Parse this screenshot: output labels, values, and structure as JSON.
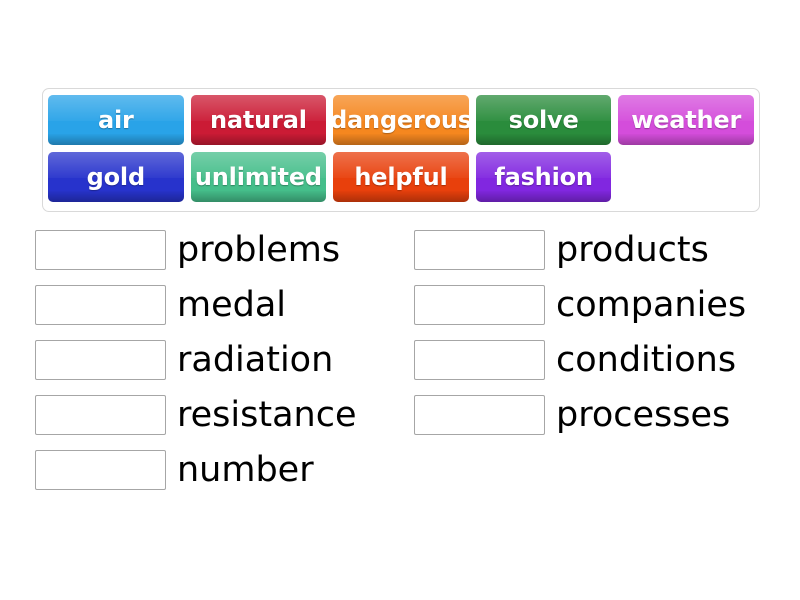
{
  "word_bank": {
    "rows": [
      [
        {
          "label": "air",
          "color": "#29A3E8"
        },
        {
          "label": "natural",
          "color": "#CB1B35"
        },
        {
          "label": "dangerous",
          "color": "#F5871F"
        },
        {
          "label": "solve",
          "color": "#2A8C3C"
        },
        {
          "label": "weather",
          "color": "#D44DDB"
        }
      ],
      [
        {
          "label": "gold",
          "color": "#2733CC"
        },
        {
          "label": "unlimited",
          "color": "#45BE8A"
        },
        {
          "label": "helpful",
          "color": "#E8400C"
        },
        {
          "label": "fashion",
          "color": "#8127E0"
        },
        {
          "label": "",
          "color": "",
          "empty": true
        }
      ]
    ]
  },
  "answers": {
    "left": [
      {
        "slot_value": "",
        "label": "problems"
      },
      {
        "slot_value": "",
        "label": "medal"
      },
      {
        "slot_value": "",
        "label": "radiation"
      },
      {
        "slot_value": "",
        "label": "resistance"
      },
      {
        "slot_value": "",
        "label": "number"
      }
    ],
    "right": [
      {
        "slot_value": "",
        "label": "products"
      },
      {
        "slot_value": "",
        "label": "companies"
      },
      {
        "slot_value": "",
        "label": "conditions"
      },
      {
        "slot_value": "",
        "label": "processes"
      }
    ]
  },
  "colors": {
    "panel_border": "#d9d9d9",
    "slot_border": "#a6a6a6",
    "background": "#ffffff",
    "label_text": "#000000",
    "tile_text": "#ffffff"
  }
}
